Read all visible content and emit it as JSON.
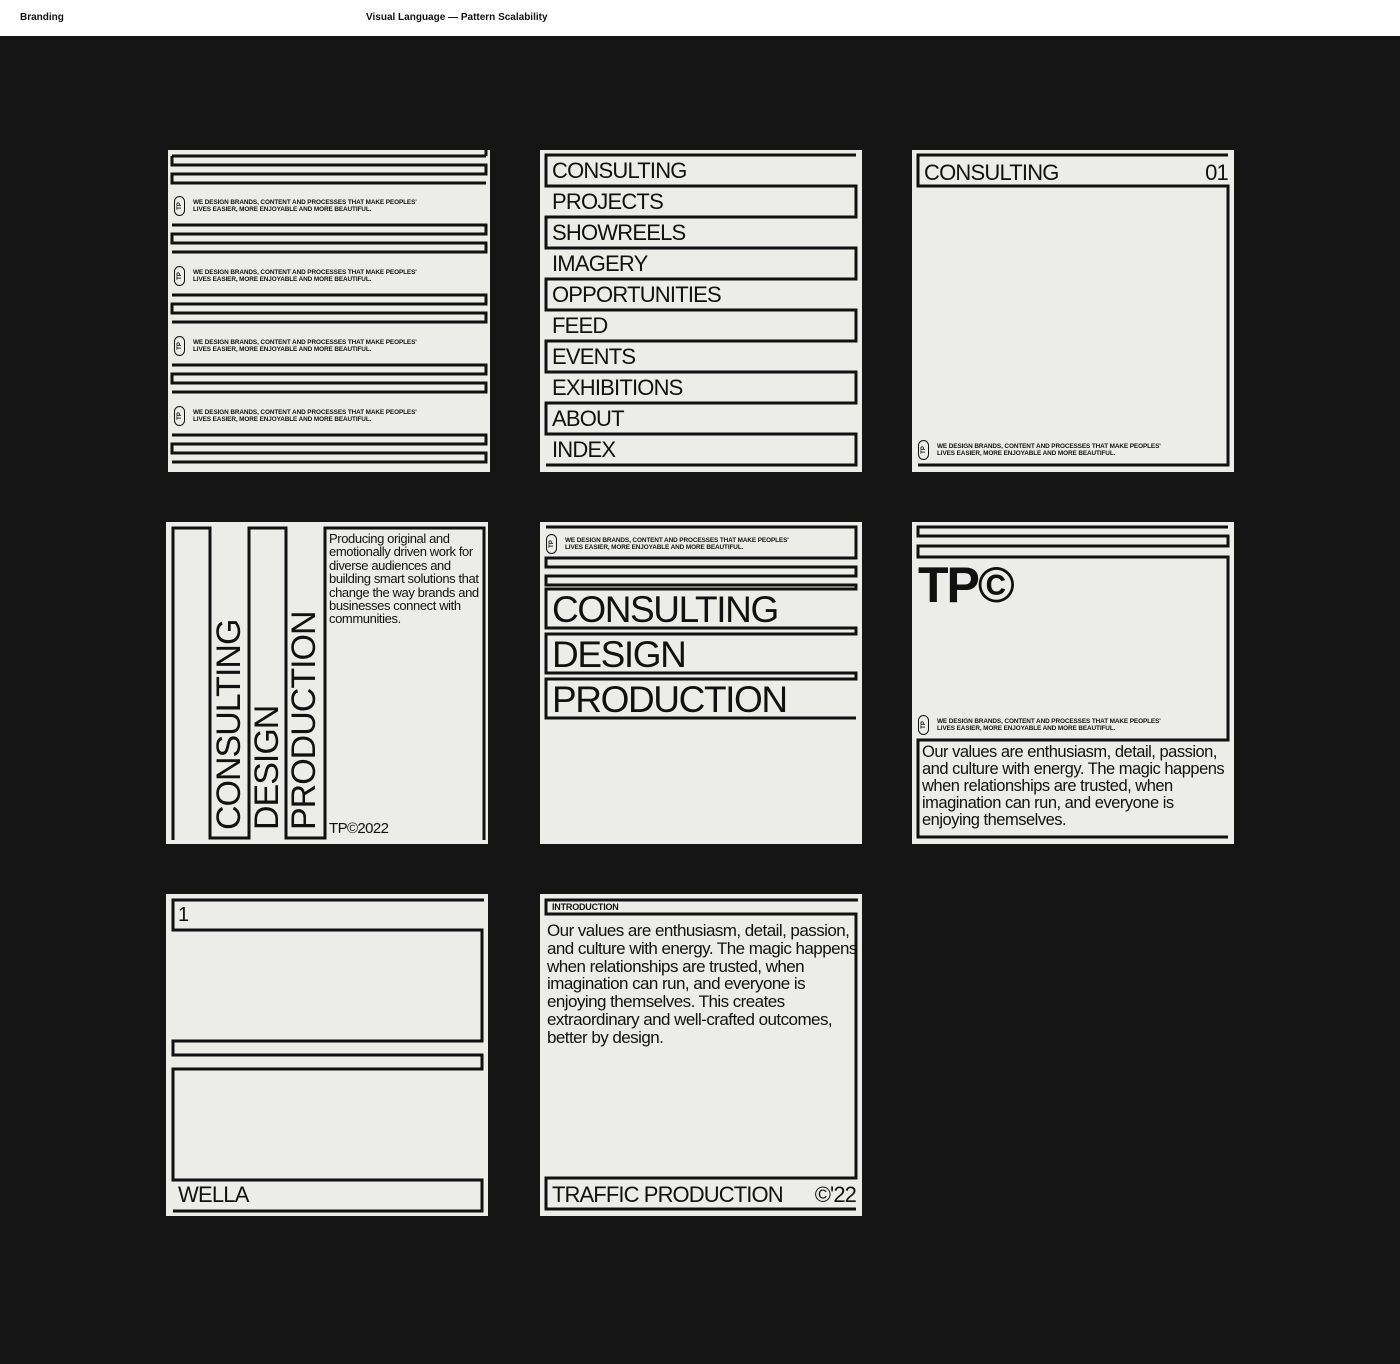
{
  "header": {
    "left_label": "Branding",
    "center_label": "Visual Language — Pattern Scalability"
  },
  "colors": {
    "page_background": "#151515",
    "card_background": "#ecece8",
    "ink": "#111111",
    "header_background": "#ffffff"
  },
  "tagline": {
    "pill": "TP",
    "line1": "WE DESIGN BRANDS, CONTENT AND PROCESSES THAT MAKE PEOPLES'",
    "line2": "LIVES EASIER, MORE ENJOYABLE AND MORE BEAUTIFUL."
  },
  "cards": {
    "menu": {
      "items": [
        "CONSULTING",
        "PROJECTS",
        "SHOWREELS",
        "IMAGERY",
        "OPPORTUNITIES",
        "FEED",
        "EVENTS",
        "EXHIBITIONS",
        "ABOUT",
        "INDEX"
      ]
    },
    "section": {
      "title": "CONSULTING",
      "number": "01"
    },
    "vertical": {
      "words": [
        "CONSULTING",
        "DESIGN",
        "PRODUCTION"
      ],
      "paragraph": "Producing original and emotionally driven work for diverse audiences and building smart solutions that change the way brands and businesses connect with communities.",
      "footer": "TP©2022"
    },
    "services": {
      "words": [
        "CONSULTING",
        "DESIGN",
        "PRODUCTION"
      ]
    },
    "logo": {
      "mark": "TP©",
      "paragraph": "Our values are enthusiasm, detail, passion, and culture with energy. The magic happens when relationships are trusted, when imagination can run, and everyone is enjoying themselves."
    },
    "client": {
      "number": "1",
      "name": "WELLA"
    },
    "intro": {
      "label": "INTRODUCTION",
      "paragraph": "Our values are enthusiasm, detail, passion, and culture with energy. The magic happens when relationships are trusted, when imagination can run, and everyone is enjoying themselves. This creates extraordinary and well-crafted outcomes, better by design.",
      "footer_left": "TRAFFIC PRODUCTION",
      "footer_right": "©'22"
    }
  }
}
